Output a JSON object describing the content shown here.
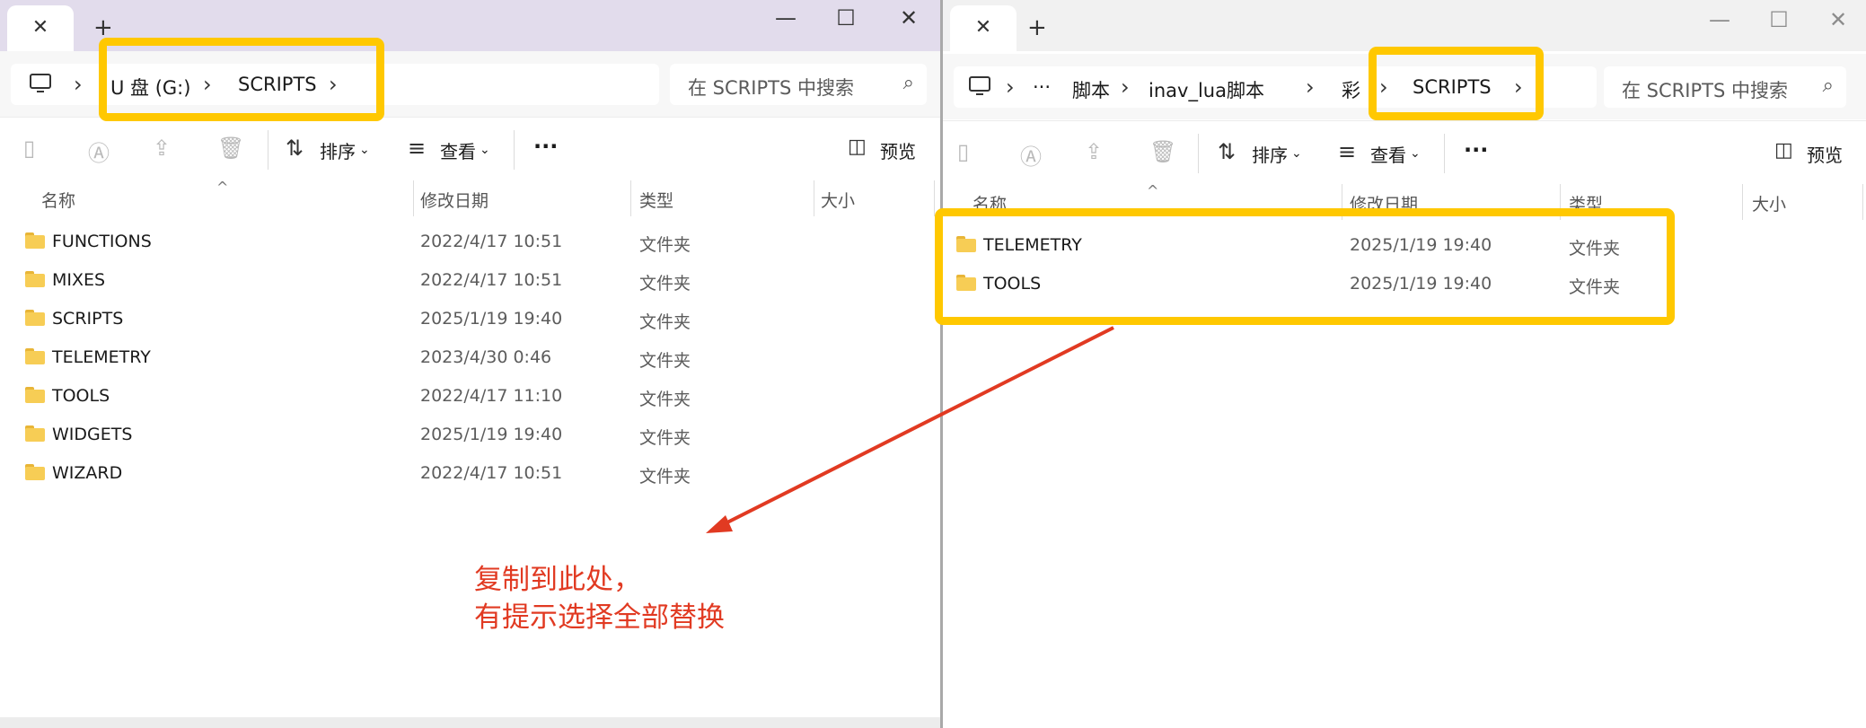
{
  "left": {
    "tab": {
      "close": "✕",
      "new": "+"
    },
    "controls": {
      "minimize": "—",
      "maximize": "☐",
      "close": "✕"
    },
    "address": {
      "crumbs": [
        "U 盘 (G:)",
        "SCRIPTS"
      ]
    },
    "search": {
      "placeholder": "在 SCRIPTS 中搜索"
    },
    "toolbar": {
      "sort": "排序",
      "view": "查看",
      "more": "···",
      "preview": "预览"
    },
    "columns": {
      "name": "名称",
      "date": "修改日期",
      "type": "类型",
      "size": "大小"
    },
    "files": [
      {
        "name": "FUNCTIONS",
        "date": "2022/4/17 10:51",
        "type": "文件夹"
      },
      {
        "name": "MIXES",
        "date": "2022/4/17 10:51",
        "type": "文件夹"
      },
      {
        "name": "SCRIPTS",
        "date": "2025/1/19 19:40",
        "type": "文件夹"
      },
      {
        "name": "TELEMETRY",
        "date": "2023/4/30 0:46",
        "type": "文件夹"
      },
      {
        "name": "TOOLS",
        "date": "2022/4/17 11:10",
        "type": "文件夹"
      },
      {
        "name": "WIDGETS",
        "date": "2025/1/19 19:40",
        "type": "文件夹"
      },
      {
        "name": "WIZARD",
        "date": "2022/4/17 10:51",
        "type": "文件夹"
      }
    ]
  },
  "right": {
    "tab": {
      "close": "✕",
      "new": "+"
    },
    "controls": {
      "minimize": "—",
      "maximize": "☐",
      "close": "✕"
    },
    "address": {
      "overflow": "···",
      "crumbs": [
        "脚本",
        "inav_lua脚本",
        "彩",
        "SCRIPTS"
      ]
    },
    "search": {
      "placeholder": "在 SCRIPTS 中搜索"
    },
    "toolbar": {
      "sort": "排序",
      "view": "查看",
      "more": "···",
      "preview": "预览"
    },
    "columns": {
      "name": "名称",
      "date": "修改日期",
      "type": "类型",
      "size": "大小"
    },
    "files": [
      {
        "name": "TELEMETRY",
        "date": "2025/1/19 19:40",
        "type": "文件夹"
      },
      {
        "name": "TOOLS",
        "date": "2025/1/19 19:40",
        "type": "文件夹"
      }
    ]
  },
  "annotation": {
    "lines": [
      "复制到此处，",
      "有提示选择全部替换"
    ],
    "highlight_color": "#ffc800",
    "arrow_color": "#e13a22"
  },
  "colors": {
    "folder": "#f7cd55",
    "left_titlebar": "#e2dcec",
    "right_titlebar": "#f1f1f1"
  }
}
